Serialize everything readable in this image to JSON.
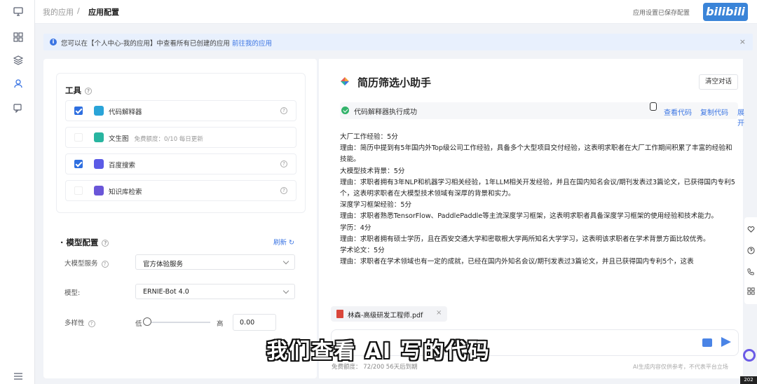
{
  "rail": {
    "icons": [
      "monitor-icon",
      "grid-icon",
      "layers-icon",
      "user-icon",
      "chat-icon",
      "list-icon"
    ]
  },
  "breadcrumb": {
    "parent": "我的应用",
    "separator": "/",
    "current": "应用配置"
  },
  "topbar": {
    "right_text": "应用设置已保存配置",
    "brand": "bilibili"
  },
  "notice": {
    "text": "您可以在【个人中心-我的应用】中查看所有已创建的应用",
    "link": "前往我的应用",
    "close": "×"
  },
  "tools": {
    "title": "工具",
    "items": [
      {
        "name": "代码解释器",
        "checked": true,
        "icon": "code-icon",
        "color": "#2aa4d8"
      },
      {
        "name": "文生图",
        "checked": false,
        "icon": "image-icon",
        "color": "#28b5a0",
        "free_label": "免费额度：0/10 每日更新"
      },
      {
        "name": "百度搜索",
        "checked": true,
        "icon": "search-icon",
        "color": "#5b5be6"
      },
      {
        "name": "知识库检索",
        "checked": false,
        "icon": "book-icon",
        "color": "#6a56d8"
      }
    ]
  },
  "model": {
    "title": "模型配置",
    "refresh": "刷新",
    "service_label": "大模型服务",
    "service_value": "官方体验服务",
    "model_label": "模型",
    "model_value": "ERNIE-Bot 4.0",
    "diversity_label": "多样性",
    "low": "低",
    "high": "高",
    "diversity_value": "0.00",
    "diversity_level": 0
  },
  "chat": {
    "title": "简历筛选小助手",
    "clear_button": "清空对话",
    "exec_status": "代码解释器执行成功",
    "actions": [
      "查看代码",
      "复制代码",
      "展开"
    ],
    "lines": [
      "大厂工作经验：5分",
      "理由：简历中提到有5年国内外Top级公司工作经验，具备多个大型项目交付经验，这表明求职者在大厂工作期间积累了丰富的经验和技能。",
      "大模型技术背景：5分",
      "理由：求职者拥有3年NLP和机器学习相关经验，1年LLM相关开发经验，并且在国内知名会议/期刊发表过3篇论文，已获得国内专利5个，这表明求职者在大模型技术领域有深厚的背景和实力。",
      "深度学习框架经验：5分",
      "理由：求职者熟悉TensorFlow、PaddlePaddle等主流深度学习框架，这表明求职者具备深度学习框架的使用经验和技术能力。",
      "学历：4分",
      "理由：求职者拥有硕士学历，且在西安交通大学和密歇根大学两所知名大学学习，这表明该求职者在学术背景方面比较优秀。",
      "学术论文：5分",
      "理由：求职者在学术领域也有一定的成就，已经在国内外知名会议/期刊发表过3篇论文，并且已获得国内专利5个，这表"
    ],
    "attachment": "林森-高级研发工程师.pdf",
    "quota": "免费额度： 72/200   56天后到期",
    "ai_note": "AI生成内容仅供参考，不代表平台立场"
  },
  "subtitle": "我们查看 AI 写的代码",
  "float_icons": [
    "heart-icon",
    "help-icon",
    "phone-icon",
    "apps-icon"
  ],
  "corner_tag": "202"
}
